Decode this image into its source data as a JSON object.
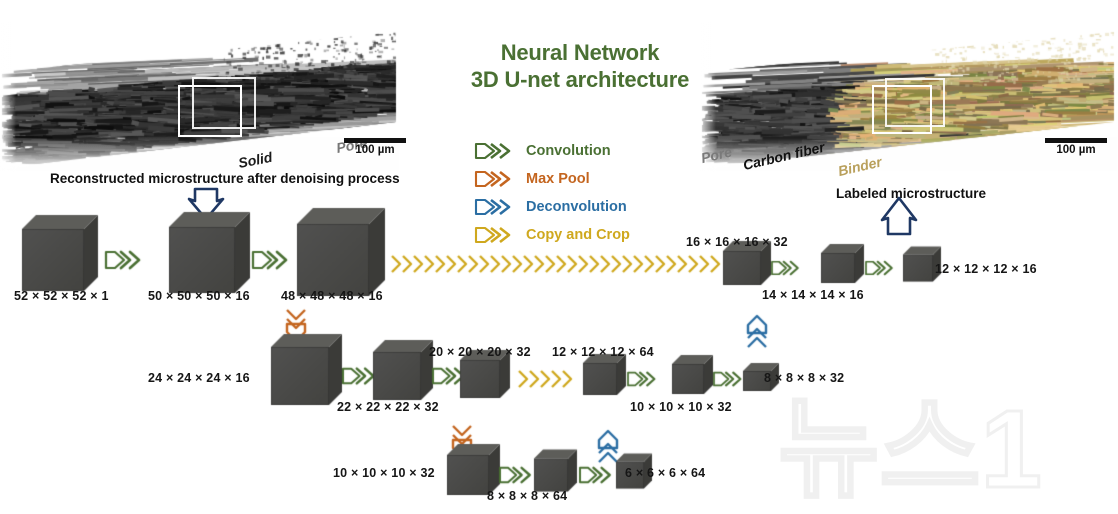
{
  "title": {
    "line1": "Neural Network",
    "line2": "3D U-net architecture",
    "color": "#4a7033"
  },
  "legend": {
    "items": [
      {
        "label": "Convolution",
        "color": "#4a7033",
        "icon": "convolution-arrow-icon"
      },
      {
        "label": "Max Pool",
        "color": "#c4651f",
        "icon": "max-pool-arrow-icon"
      },
      {
        "label": "Deconvolution",
        "color": "#2b6ea3",
        "icon": "deconvolution-arrow-icon"
      },
      {
        "label": "Copy and Crop",
        "color": "#cfa81e",
        "icon": "copy-and-crop-arrow-icon"
      }
    ]
  },
  "left_panel": {
    "caption": "Reconstructed microstructure after denoising process",
    "labels": [
      {
        "text": "Solid",
        "color": "#1a1a1a"
      },
      {
        "text": "Pore",
        "color": "#6e6e6e"
      }
    ],
    "scalebar": "100 µm"
  },
  "right_panel": {
    "caption": "Labeled microstructure",
    "labels": [
      {
        "text": "Pore",
        "color": "#6e6e6e"
      },
      {
        "text": "Carbon fiber",
        "color": "#1a1a1a"
      },
      {
        "text": "Binder",
        "color": "#b9a05c"
      }
    ],
    "scalebar": "100 µm"
  },
  "network": {
    "row1": {
      "dims": [
        "52 × 52 × 52 × 1",
        "50 × 50 × 50 × 16",
        "48 × 48 × 48 × 16",
        "16 × 16 × 16 × 32",
        "14 × 14 × 14 × 16",
        "12 × 12 × 12 × 16"
      ]
    },
    "row2": {
      "dims": [
        "24 × 24 × 24 × 16",
        "22 × 22 × 22 × 32",
        "20 × 20 × 20 × 32",
        "12 × 12 × 12 × 64",
        "10 × 10 × 10 × 32",
        "8 × 8 × 8 × 32"
      ]
    },
    "row3": {
      "dims": [
        "10 × 10 × 10 × 32",
        "8 × 8 × 8 × 64",
        "6 × 6 × 6 × 64"
      ]
    }
  },
  "watermark": {
    "text": "뉴스1"
  },
  "colors": {
    "convolution": "#4a7033",
    "max_pool": "#c4651f",
    "deconvolution": "#2b6ea3",
    "copy_crop": "#cfa81e",
    "io_arrow": "#1f3864",
    "cube_front": "#4a4a47",
    "cube_top": "#5d5d59",
    "cube_side": "#3b3b38"
  }
}
